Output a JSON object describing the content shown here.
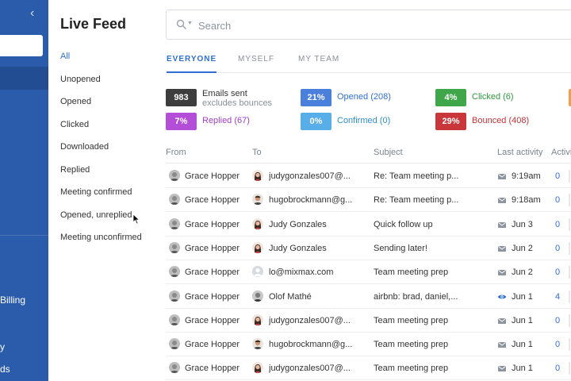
{
  "nav": {
    "items": [
      "Billing",
      "y",
      "ds"
    ]
  },
  "filters": {
    "title": "Live Feed",
    "items": [
      "All",
      "Unopened",
      "Opened",
      "Clicked",
      "Downloaded",
      "Replied",
      "Meeting confirmed",
      "Opened, unreplied",
      "Meeting unconfirmed"
    ],
    "active_index": 0
  },
  "search": {
    "placeholder": "Search"
  },
  "tabs": [
    "EVERYONE",
    "MYSELF",
    "MY TEAM"
  ],
  "stats": {
    "emails_sent": {
      "value": "983",
      "label": "Emails sent",
      "sublabel": "excludes bounces",
      "color": "#3d3d3d"
    },
    "opened": {
      "value": "21%",
      "label": "Opened (208)",
      "color": "#4a7fdc",
      "text_color": "#2f6fd1"
    },
    "clicked": {
      "value": "4%",
      "label": "Clicked (6)",
      "color": "#3fa74a",
      "text_color": "#2f9a3b"
    },
    "replied": {
      "value": "7%",
      "label": "Replied (67)",
      "color": "#b44ed9",
      "text_color": "#a23fc7"
    },
    "confirmed": {
      "value": "0%",
      "label": "Confirmed (0)",
      "color": "#57aee8",
      "text_color": "#2f8fd1"
    },
    "bounced": {
      "value": "29%",
      "label": "Bounced (408)",
      "color": "#c9373a",
      "text_color": "#c23236"
    },
    "extra_color": "#f0a04b"
  },
  "table": {
    "headers": {
      "from": "From",
      "to": "To",
      "subject": "Subject",
      "last_activity": "Last activity",
      "activity": "Activi"
    },
    "rows": [
      {
        "from": "Grace Hopper",
        "to": "judygonzales007@...",
        "to_avatar": "woman",
        "subject": "Re: Team meeting p...",
        "icon": "mail-icon",
        "last": "9:19am",
        "count": "0"
      },
      {
        "from": "Grace Hopper",
        "to": "hugobrockmann@g...",
        "to_avatar": "man",
        "subject": "Re: Team meeting p...",
        "icon": "mail-icon",
        "last": "9:18am",
        "count": "0"
      },
      {
        "from": "Grace Hopper",
        "to": "Judy Gonzales",
        "to_avatar": "woman",
        "subject": "Quick follow up",
        "icon": "mail-icon",
        "last": "Jun 3",
        "count": "0"
      },
      {
        "from": "Grace Hopper",
        "to": "Judy Gonzales",
        "to_avatar": "woman",
        "subject": "Sending later!",
        "icon": "mail-icon",
        "last": "Jun 2",
        "count": "0"
      },
      {
        "from": "Grace Hopper",
        "to": "lo@mixmax.com",
        "to_avatar": "default",
        "subject": "Team meeting prep",
        "icon": "mail-icon",
        "last": "Jun 2",
        "count": "0"
      },
      {
        "from": "Grace Hopper",
        "to": "Olof Mathé",
        "to_avatar": "olof",
        "subject": "airbnb: brad, daniel,...",
        "icon": "eye-icon",
        "last": "Jun 1",
        "count": "4"
      },
      {
        "from": "Grace Hopper",
        "to": "judygonzales007@...",
        "to_avatar": "woman",
        "subject": "Team meeting prep",
        "icon": "mail-icon",
        "last": "Jun 1",
        "count": "0"
      },
      {
        "from": "Grace Hopper",
        "to": "hugobrockmann@g...",
        "to_avatar": "man",
        "subject": "Team meeting prep",
        "icon": "mail-icon",
        "last": "Jun 1",
        "count": "0"
      },
      {
        "from": "Grace Hopper",
        "to": "judygonzales007@...",
        "to_avatar": "woman",
        "subject": "Team meeting prep",
        "icon": "mail-icon",
        "last": "Jun 1",
        "count": "0"
      }
    ]
  }
}
